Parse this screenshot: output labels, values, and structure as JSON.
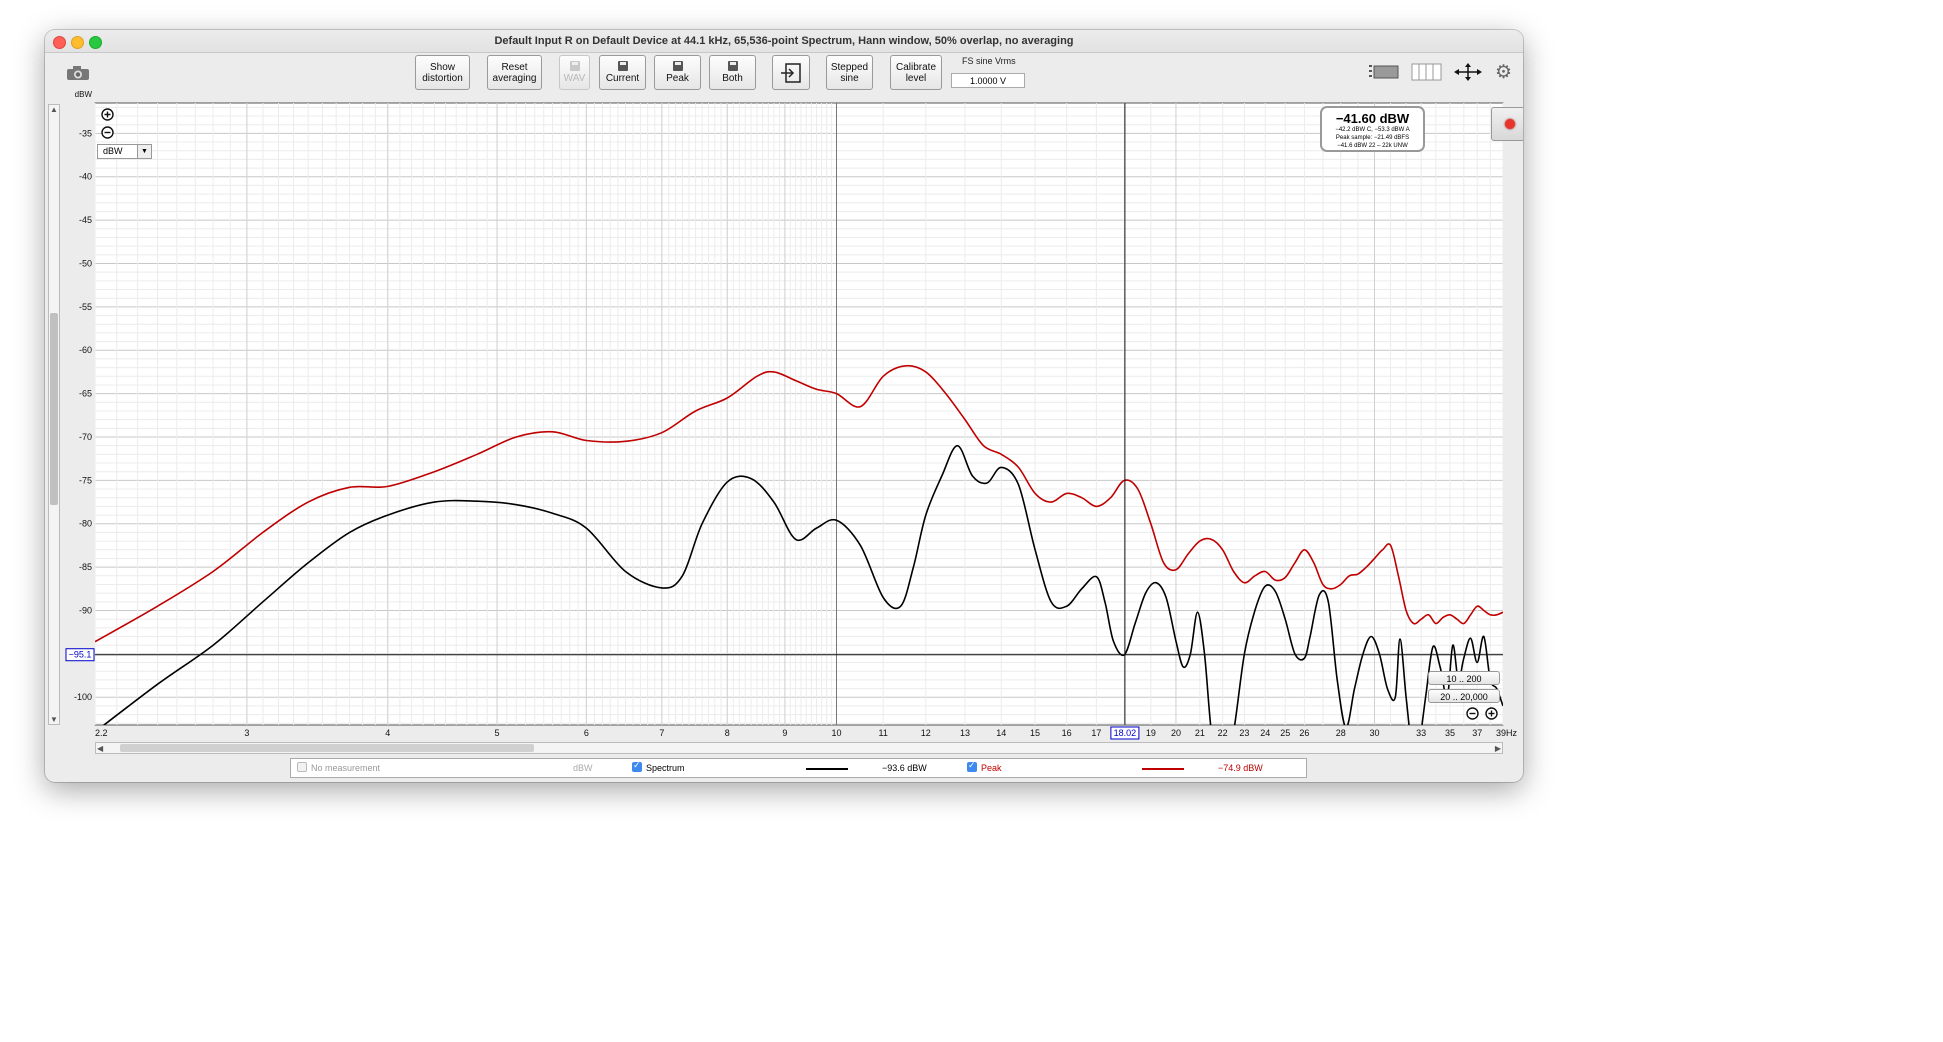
{
  "window": {
    "title": "Default Input R on Default Device at 44.1 kHz, 65,536-point Spectrum, Hann window, 50% overlap, no averaging"
  },
  "toolbar": {
    "show_distortion": [
      "Show",
      "distortion"
    ],
    "reset_averaging": [
      "Reset",
      "averaging"
    ],
    "wav": "WAV",
    "current": "Current",
    "peak": "Peak",
    "both": "Both",
    "stepped_sine": [
      "Stepped",
      "sine"
    ],
    "calibrate_level": [
      "Calibrate",
      "level"
    ],
    "fs_label": "FS sine Vrms",
    "fs_value": "1.0000 V"
  },
  "icons": [
    "camera-icon",
    "save-icon",
    "import-icon",
    "layout-icon",
    "columns-icon",
    "move-arrows-icon",
    "gear-icon",
    "zoom-in-icon",
    "zoom-out-icon",
    "record-icon",
    "dropdown-arrow-icon"
  ],
  "unit_select": "dBW",
  "readout": {
    "main": "−41.60 dBW",
    "line1": "−42.2 dBW C, −53.3 dBW A",
    "line2": "Peak sample: −21.49 dBFS",
    "line3": "−41.6 dBW 22 – 22k UNW"
  },
  "cursor": {
    "x_label": "18.02",
    "y_label": "−95.1",
    "x": 18.02,
    "y": -95.1
  },
  "range_buttons": [
    "10 .. 200",
    "20 .. 20,000"
  ],
  "legend": {
    "no_measurement": "No measurement",
    "no_measurement_unit": "dBW",
    "spectrum_label": "Spectrum",
    "spectrum_value": "−93.6 dBW",
    "peak_label": "Peak",
    "peak_value": "−74.9 dBW"
  },
  "colors": {
    "spectrum": "#000000",
    "peak": "#c00000",
    "cursor_label": "#0000cc"
  },
  "chart_data": {
    "type": "line",
    "ylabel": "dBW",
    "xlabel_unit": "Hz",
    "x_scale": "log",
    "xlim": [
      2.2,
      39
    ],
    "ylim": [
      -103.2,
      -31.5
    ],
    "x_tick_labels": [
      {
        "v": 2.2,
        "t": "2.2"
      },
      {
        "v": 3,
        "t": "3"
      },
      {
        "v": 4,
        "t": "4"
      },
      {
        "v": 5,
        "t": "5"
      },
      {
        "v": 6,
        "t": "6"
      },
      {
        "v": 7,
        "t": "7"
      },
      {
        "v": 8,
        "t": "8"
      },
      {
        "v": 9,
        "t": "9"
      },
      {
        "v": 10,
        "t": "10"
      },
      {
        "v": 11,
        "t": "11"
      },
      {
        "v": 12,
        "t": "12"
      },
      {
        "v": 13,
        "t": "13"
      },
      {
        "v": 14,
        "t": "14"
      },
      {
        "v": 15,
        "t": "15"
      },
      {
        "v": 16,
        "t": "16"
      },
      {
        "v": 17,
        "t": "17"
      },
      {
        "v": 19,
        "t": "19"
      },
      {
        "v": 20,
        "t": "20"
      },
      {
        "v": 21,
        "t": "21"
      },
      {
        "v": 22,
        "t": "22"
      },
      {
        "v": 23,
        "t": "23"
      },
      {
        "v": 24,
        "t": "24"
      },
      {
        "v": 25,
        "t": "25"
      },
      {
        "v": 26,
        "t": "26"
      },
      {
        "v": 28,
        "t": "28"
      },
      {
        "v": 30,
        "t": "30"
      },
      {
        "v": 33,
        "t": "33"
      },
      {
        "v": 35,
        "t": "35"
      },
      {
        "v": 37,
        "t": "37"
      },
      {
        "v": 39,
        "t": "39Hz"
      }
    ],
    "y_ticks": [
      -35,
      -40,
      -45,
      -50,
      -55,
      -60,
      -65,
      -70,
      -75,
      -80,
      -85,
      -90,
      -100
    ],
    "grid": true,
    "series": [
      {
        "name": "Spectrum",
        "x": [
          2.2,
          2.5,
          2.8,
          3.1,
          3.4,
          3.7,
          4.0,
          4.4,
          4.8,
          5.2,
          5.6,
          6.0,
          6.5,
          7.0,
          7.3,
          7.6,
          8.0,
          8.4,
          8.8,
          9.2,
          9.6,
          10.0,
          10.5,
          11.0,
          11.4,
          11.7,
          12.0,
          12.4,
          12.8,
          13.2,
          13.6,
          14.0,
          14.5,
          15.0,
          15.5,
          16.0,
          16.5,
          17.0,
          17.3,
          17.6,
          18.0,
          18.4,
          18.8,
          19.2,
          19.6,
          20.0,
          20.3,
          20.6,
          20.9,
          21.2,
          21.5,
          21.8,
          22.0,
          22.5,
          23.0,
          23.5,
          24.0,
          24.5,
          25.0,
          25.5,
          26.0,
          26.3,
          26.8,
          27.3,
          27.8,
          28.3,
          28.8,
          29.3,
          29.8,
          30.3,
          30.8,
          31.3,
          31.6,
          32.0,
          32.4,
          32.8,
          33.3,
          33.8,
          34.3,
          34.8,
          35.2,
          35.6,
          36.0,
          36.5,
          37.0,
          37.5,
          38.0,
          38.5,
          39.0
        ],
        "y": [
          -104,
          -98.5,
          -94,
          -89,
          -84.5,
          -81,
          -79,
          -77.5,
          -77.4,
          -77.8,
          -78.8,
          -80.5,
          -85.5,
          -87.4,
          -86,
          -80,
          -75.2,
          -74.8,
          -77.5,
          -81.8,
          -80.5,
          -79.6,
          -82.5,
          -88.5,
          -89.5,
          -85,
          -79,
          -74.5,
          -71,
          -74.5,
          -75.3,
          -73.5,
          -75.5,
          -83,
          -89,
          -89.5,
          -87.5,
          -86.1,
          -89,
          -93.5,
          -95.1,
          -91.5,
          -88,
          -86.8,
          -88.5,
          -93.5,
          -96.5,
          -95,
          -90.2,
          -95,
          -104,
          -107,
          -110,
          -104,
          -95,
          -90,
          -87.2,
          -87.8,
          -91,
          -95,
          -95.5,
          -93,
          -88.2,
          -89,
          -98,
          -103.5,
          -99,
          -95,
          -93,
          -95,
          -99,
          -100,
          -93.3,
          -100,
          -106,
          -106,
          -100,
          -94.2,
          -96.5,
          -100,
          -94,
          -98,
          -95.5,
          -93.2,
          -96,
          -93,
          -98,
          -99,
          -101
        ]
      },
      {
        "name": "Peak",
        "x": [
          2.2,
          2.5,
          2.8,
          3.1,
          3.4,
          3.7,
          4.0,
          4.4,
          4.8,
          5.2,
          5.6,
          6.0,
          6.5,
          7.0,
          7.5,
          8.0,
          8.5,
          8.8,
          9.2,
          9.6,
          10.0,
          10.5,
          11.0,
          11.5,
          12.0,
          12.5,
          13.0,
          13.5,
          14.0,
          14.5,
          15.0,
          15.5,
          16.0,
          16.5,
          17.0,
          17.5,
          18.0,
          18.5,
          19.0,
          19.5,
          20.0,
          20.5,
          21.0,
          21.5,
          22.0,
          22.5,
          23.0,
          23.5,
          24.0,
          24.5,
          25.0,
          25.5,
          26.0,
          26.5,
          27.0,
          27.5,
          28.0,
          28.5,
          29.0,
          29.5,
          30.0,
          30.5,
          31.0,
          31.5,
          32.0,
          32.5,
          33.0,
          33.5,
          34.0,
          34.5,
          35.0,
          35.5,
          36.0,
          36.5,
          37.0,
          37.5,
          38.0,
          38.5,
          39.0
        ],
        "y": [
          -93.6,
          -89.5,
          -85.5,
          -81,
          -77.5,
          -75.8,
          -75.7,
          -74,
          -72,
          -70,
          -69.4,
          -70.4,
          -70.5,
          -69.5,
          -67,
          -65.5,
          -63,
          -62.5,
          -63.5,
          -64.5,
          -65,
          -66.5,
          -63,
          -61.8,
          -62.5,
          -65,
          -68,
          -71,
          -72,
          -73.5,
          -76.5,
          -77.5,
          -76.5,
          -77,
          -78,
          -77,
          -75,
          -76,
          -80,
          -84.5,
          -85.3,
          -83.5,
          -82,
          -81.8,
          -83,
          -85.5,
          -86.8,
          -86,
          -85.5,
          -86.5,
          -86.2,
          -84.5,
          -83,
          -84.5,
          -87,
          -87.5,
          -87,
          -86,
          -85.8,
          -85,
          -84,
          -83,
          -82.5,
          -86,
          -90,
          -91.5,
          -91,
          -90.5,
          -91.5,
          -90.8,
          -90.5,
          -91,
          -91.5,
          -90.5,
          -89.5,
          -90,
          -90.5,
          -90.5,
          -90.2
        ]
      }
    ]
  }
}
